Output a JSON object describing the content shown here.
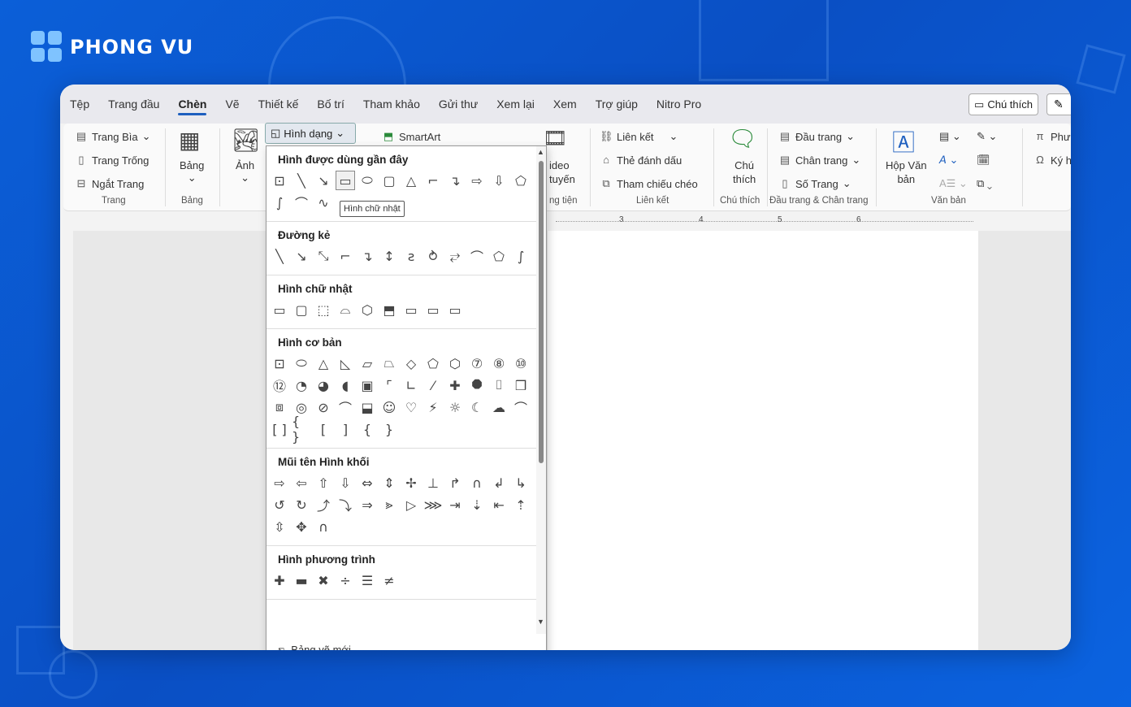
{
  "brand": {
    "name": "PHONG VU"
  },
  "tabs": [
    "Tệp",
    "Trang đầu",
    "Chèn",
    "Vẽ",
    "Thiết kế",
    "Bố trí",
    "Tham khảo",
    "Gửi thư",
    "Xem lại",
    "Xem",
    "Trợ giúp",
    "Nitro Pro"
  ],
  "active_tab": "Chèn",
  "comment_button": "Chú thích",
  "ribbon": {
    "pages": {
      "items": [
        "Trang Bìa",
        "Trang Trống",
        "Ngắt Trang"
      ],
      "label": "Trang"
    },
    "table": {
      "button": "Bảng",
      "label": "Bảng"
    },
    "picture": {
      "button": "Ảnh"
    },
    "shapes_button": "Hình dạng",
    "smartart": "SmartArt",
    "video": {
      "line1": "ideo",
      "line2": "tuyến",
      "label": "ng tiện"
    },
    "links": {
      "items": [
        "Liên kết",
        "Thẻ đánh dấu",
        "Tham chiếu chéo"
      ],
      "label": "Liên kết"
    },
    "comments": {
      "line1": "Chú",
      "line2": "thích",
      "label": "Chú thích"
    },
    "header_footer": {
      "items": [
        "Đầu trang",
        "Chân trang",
        "Số Trang"
      ],
      "label": "Đầu trang & Chân trang"
    },
    "text": {
      "textbox_line1": "Hộp Văn",
      "textbox_line2": "bản",
      "label": "Văn bản"
    },
    "symbols": {
      "items": [
        "Phư",
        "Ký h"
      ]
    }
  },
  "ruler": {
    "marks": [
      "3",
      "4",
      "5",
      "6"
    ]
  },
  "shapes_menu": {
    "sections": [
      {
        "title": "Hình được dùng gần đây",
        "rows": [
          [
            "⊡",
            "╲",
            "↘",
            "▭",
            "⬭",
            "▢",
            "△",
            "⌐",
            "↴",
            "⇨",
            "⇩",
            "⬠"
          ],
          [
            "∫",
            "⌒",
            "∿"
          ]
        ]
      },
      {
        "title": "Đường kẻ",
        "rows": [
          [
            "╲",
            "↘",
            "⤡",
            "⌐",
            "↴",
            "↕",
            "ƨ",
            "⥁",
            "⥂",
            "⌒",
            "⬠",
            "∫"
          ]
        ]
      },
      {
        "title": "Hình chữ nhật",
        "rows": [
          [
            "▭",
            "▢",
            "⬚",
            "⌓",
            "⬡",
            "⬒",
            "▭",
            "▭",
            "▭"
          ]
        ]
      },
      {
        "title": "Hình cơ bản",
        "rows": [
          [
            "⊡",
            "⬭",
            "△",
            "◺",
            "▱",
            "⏢",
            "◇",
            "⬠",
            "⬡",
            "⑦",
            "⑧",
            "⑩"
          ],
          [
            "⑫",
            "◔",
            "◕",
            "◖",
            "▣",
            "⌜",
            "∟",
            "⁄",
            "✚",
            "⯃",
            "⌷",
            "❒"
          ],
          [
            "⧈",
            "◎",
            "⊘",
            "⌒",
            "⬓",
            "☺",
            "♡",
            "⚡",
            "☼",
            "☾",
            "☁",
            "⌒"
          ],
          [
            "[ ]",
            "{ }",
            "[",
            "]",
            "{",
            "}"
          ]
        ]
      },
      {
        "title": "Mũi tên Hình khối",
        "rows": [
          [
            "⇨",
            "⇦",
            "⇧",
            "⇩",
            "⇔",
            "⇕",
            "✢",
            "⊥",
            "↱",
            "∩",
            "↲",
            "↳"
          ],
          [
            "↺",
            "↻",
            "⤴",
            "⤵",
            "⇒",
            "⪢",
            "▷",
            "⋙",
            "⇥",
            "⇣",
            "⇤",
            "⇡"
          ],
          [
            "⇳",
            "✥",
            "∩"
          ]
        ]
      },
      {
        "title": "Hình phương trình",
        "rows": [
          [
            "✚",
            "▬",
            "✖",
            "÷",
            "☰",
            "≠"
          ]
        ]
      }
    ],
    "tooltip": "Hình chữ nhật",
    "new_canvas": "Bảng vẽ mới"
  }
}
